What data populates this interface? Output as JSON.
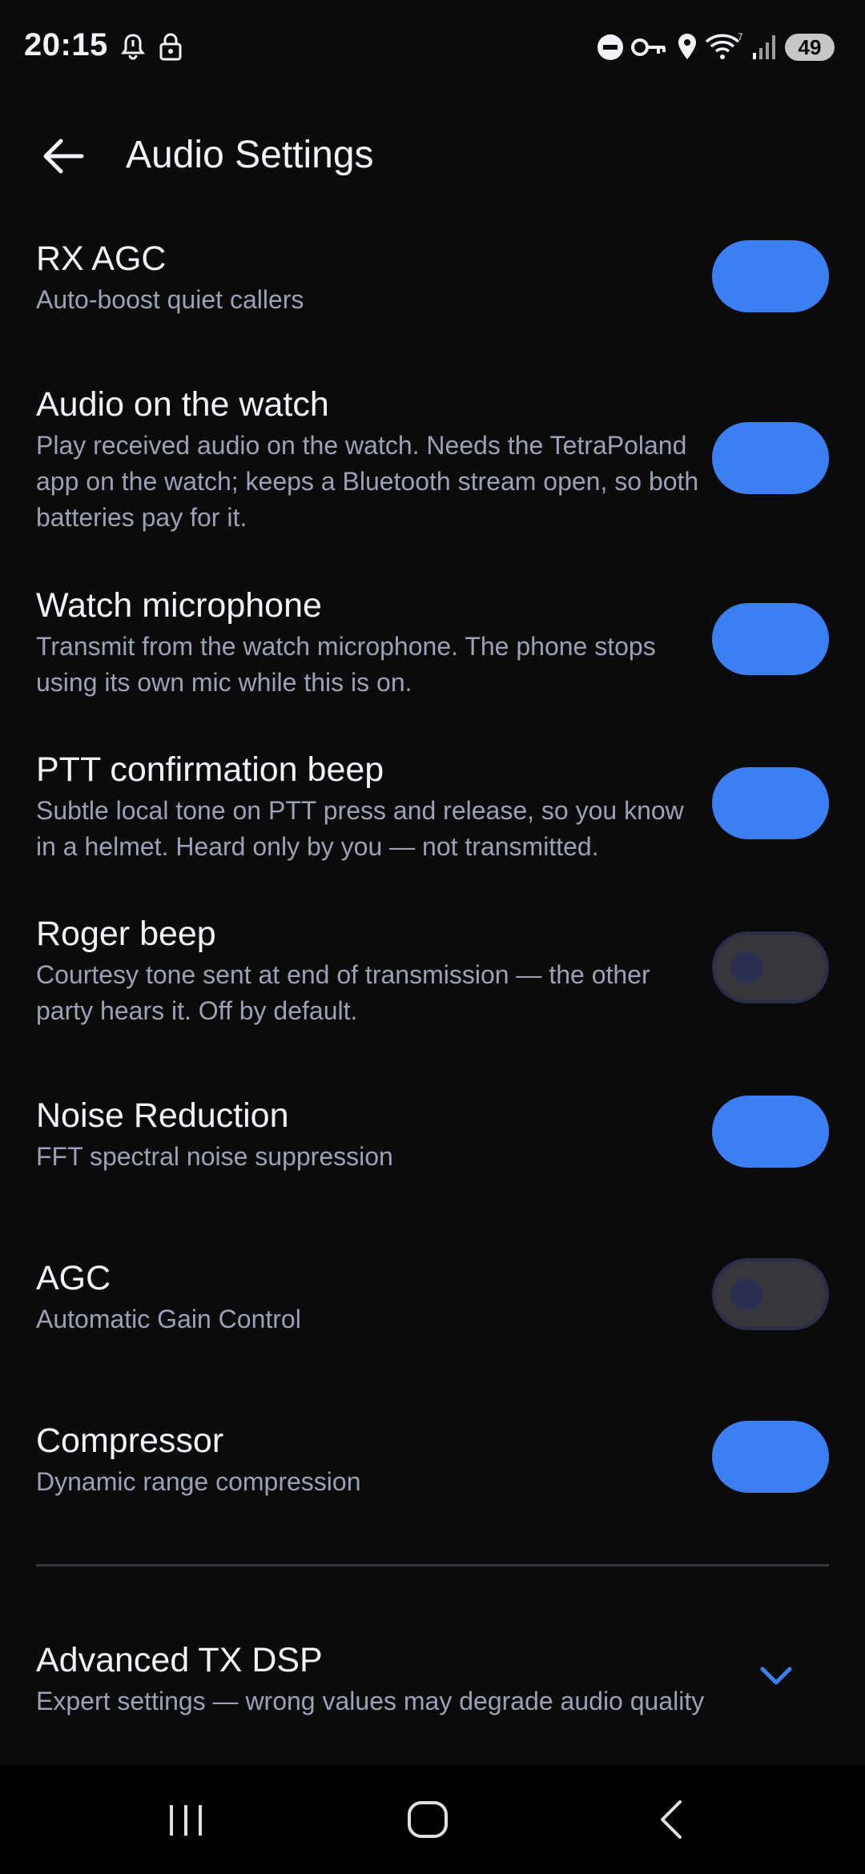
{
  "status_bar": {
    "time": "20:15",
    "battery": "49",
    "icons": [
      "notification-bell-icon",
      "lock-icon",
      "do-not-disturb-icon",
      "vpn-key-icon",
      "location-icon",
      "wifi-icon",
      "signal-icon"
    ]
  },
  "app_bar": {
    "back_icon": "arrow-left-icon",
    "title": "Audio Settings"
  },
  "settings": [
    {
      "title": "RX AGC",
      "subtitle": "Auto-boost quiet callers",
      "enabled": true
    },
    {
      "title": "Audio on the watch",
      "subtitle": "Play received audio on the watch. Needs the TetraPoland app on the watch; keeps a Bluetooth stream open, so both batteries pay for it.",
      "enabled": true
    },
    {
      "title": "Watch microphone",
      "subtitle": "Transmit from the watch microphone. The phone stops using its own mic while this is on.",
      "enabled": true
    },
    {
      "title": "PTT confirmation beep",
      "subtitle": "Subtle local tone on PTT press and release, so you know in a helmet. Heard only by you — not transmitted.",
      "enabled": true
    },
    {
      "title": "Roger beep",
      "subtitle": "Courtesy tone sent at end of transmission — the other party hears it. Off by default.",
      "enabled": false
    },
    {
      "title": "Noise Reduction",
      "subtitle": "FFT spectral noise suppression",
      "enabled": true
    },
    {
      "title": "AGC",
      "subtitle": "Automatic Gain Control",
      "enabled": false
    },
    {
      "title": "Compressor",
      "subtitle": "Dynamic range compression",
      "enabled": true
    }
  ],
  "advanced": {
    "title": "Advanced TX DSP",
    "subtitle": "Expert settings — wrong values may degrade audio quality",
    "icon": "chevron-down-icon"
  },
  "nav_bar": {
    "icons": [
      "recent-apps-icon",
      "home-icon",
      "back-icon"
    ]
  },
  "colors": {
    "background": "#0b0b0c",
    "accent": "#3c7ff2",
    "text_primary": "#f1f3f8",
    "text_secondary": "#9ba2b4",
    "switch_off_track": "#36363c"
  }
}
